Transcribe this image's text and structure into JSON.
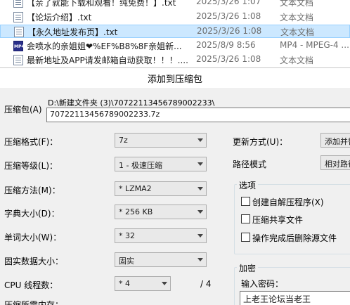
{
  "files": [
    {
      "name": "【亲了就能下载和观看！纯免费！】.txt",
      "date": "2025/3/26 1:07",
      "type": "文本文档",
      "icon": "text-file-icon"
    },
    {
      "name": "【论坛介绍】.txt",
      "date": "2025/3/26 1:08",
      "type": "文本文档",
      "icon": "text-file-icon"
    },
    {
      "name": "【永久地址发布页】.txt",
      "date": "2025/3/26 1:08",
      "type": "文本文档",
      "icon": "text-file-icon"
    },
    {
      "name": "会喷水的亲姐姐❤%EF%B8%8F亲姐新...",
      "date": "2025/8/9 8:56",
      "type": "MP4 - MPEG-4 ...",
      "icon": "mp4-file-icon",
      "icon_text": "MP4"
    },
    {
      "name": "最新地址及APP请发邮箱自动获取！！！....",
      "date": "2025/3/26 1:08",
      "type": "文本文档",
      "icon": "text-file-icon"
    }
  ],
  "dialog": {
    "title": "添加到压缩包",
    "archive_label": "压缩包(A)",
    "archive_path": "D:\\新建文件夹 (3)\\70722113456789002233\\",
    "archive_name": "70722113456789002233.7z",
    "format_label": "压缩格式(F)：",
    "format_value": "7z",
    "level_label": "压缩等级(L)：",
    "level_value": "1 - 极速压缩",
    "method_label": "压缩方法(M)：",
    "method_value": "* LZMA2",
    "dict_label": "字典大小(D)：",
    "dict_value": "* 256 KB",
    "word_label": "单词大小(W)：",
    "word_value": "* 32",
    "solid_label": "固实数据大小：",
    "solid_value": "固实",
    "threads_label": "CPU 线程数：",
    "threads_value": "* 4",
    "threads_total": "/ 4",
    "memory_label": "压缩所需内存：",
    "update_label": "更新方式(U)：",
    "update_value": "添加并替",
    "pathmode_label": "路径模式",
    "pathmode_value": "相对路径",
    "options_title": "选项",
    "opt_sfx": "创建自解压程序(X)",
    "opt_shared": "压缩共享文件",
    "opt_delete": "操作完成后删除源文件",
    "encrypt_title": "加密",
    "password_label": "输入密码：",
    "password_value": "上老王论坛当老王"
  },
  "colors": {
    "selection_bg": "#cce8ff",
    "dialog_bg": "#f0f0f0"
  }
}
